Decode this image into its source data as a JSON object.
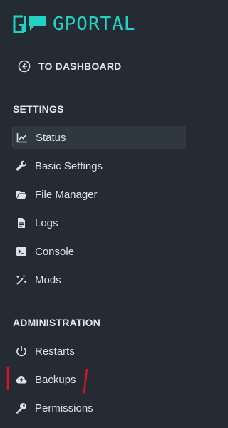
{
  "brand": {
    "name": "GPORTAL",
    "accent_color": "#22d3c5"
  },
  "back_link": {
    "label": "TO DASHBOARD",
    "icon": "arrow-left-circle-icon"
  },
  "sections": {
    "settings": {
      "title": "SETTINGS",
      "items": [
        {
          "label": "Status",
          "icon": "chart-line-icon",
          "active": true
        },
        {
          "label": "Basic Settings",
          "icon": "wrench-icon",
          "active": false
        },
        {
          "label": "File Manager",
          "icon": "folder-open-icon",
          "active": false
        },
        {
          "label": "Logs",
          "icon": "document-icon",
          "active": false
        },
        {
          "label": "Console",
          "icon": "terminal-icon",
          "active": false
        },
        {
          "label": "Mods",
          "icon": "magic-wand-icon",
          "active": false
        }
      ]
    },
    "administration": {
      "title": "ADMINISTRATION",
      "items": [
        {
          "label": "Restarts",
          "icon": "power-icon",
          "active": false
        },
        {
          "label": "Backups",
          "icon": "cloud-upload-icon",
          "active": false
        },
        {
          "label": "Permissions",
          "icon": "key-icon",
          "active": false
        }
      ]
    }
  },
  "colors": {
    "background": "#242b33",
    "active_item": "#2f3841",
    "annotation": "#e0102a"
  }
}
